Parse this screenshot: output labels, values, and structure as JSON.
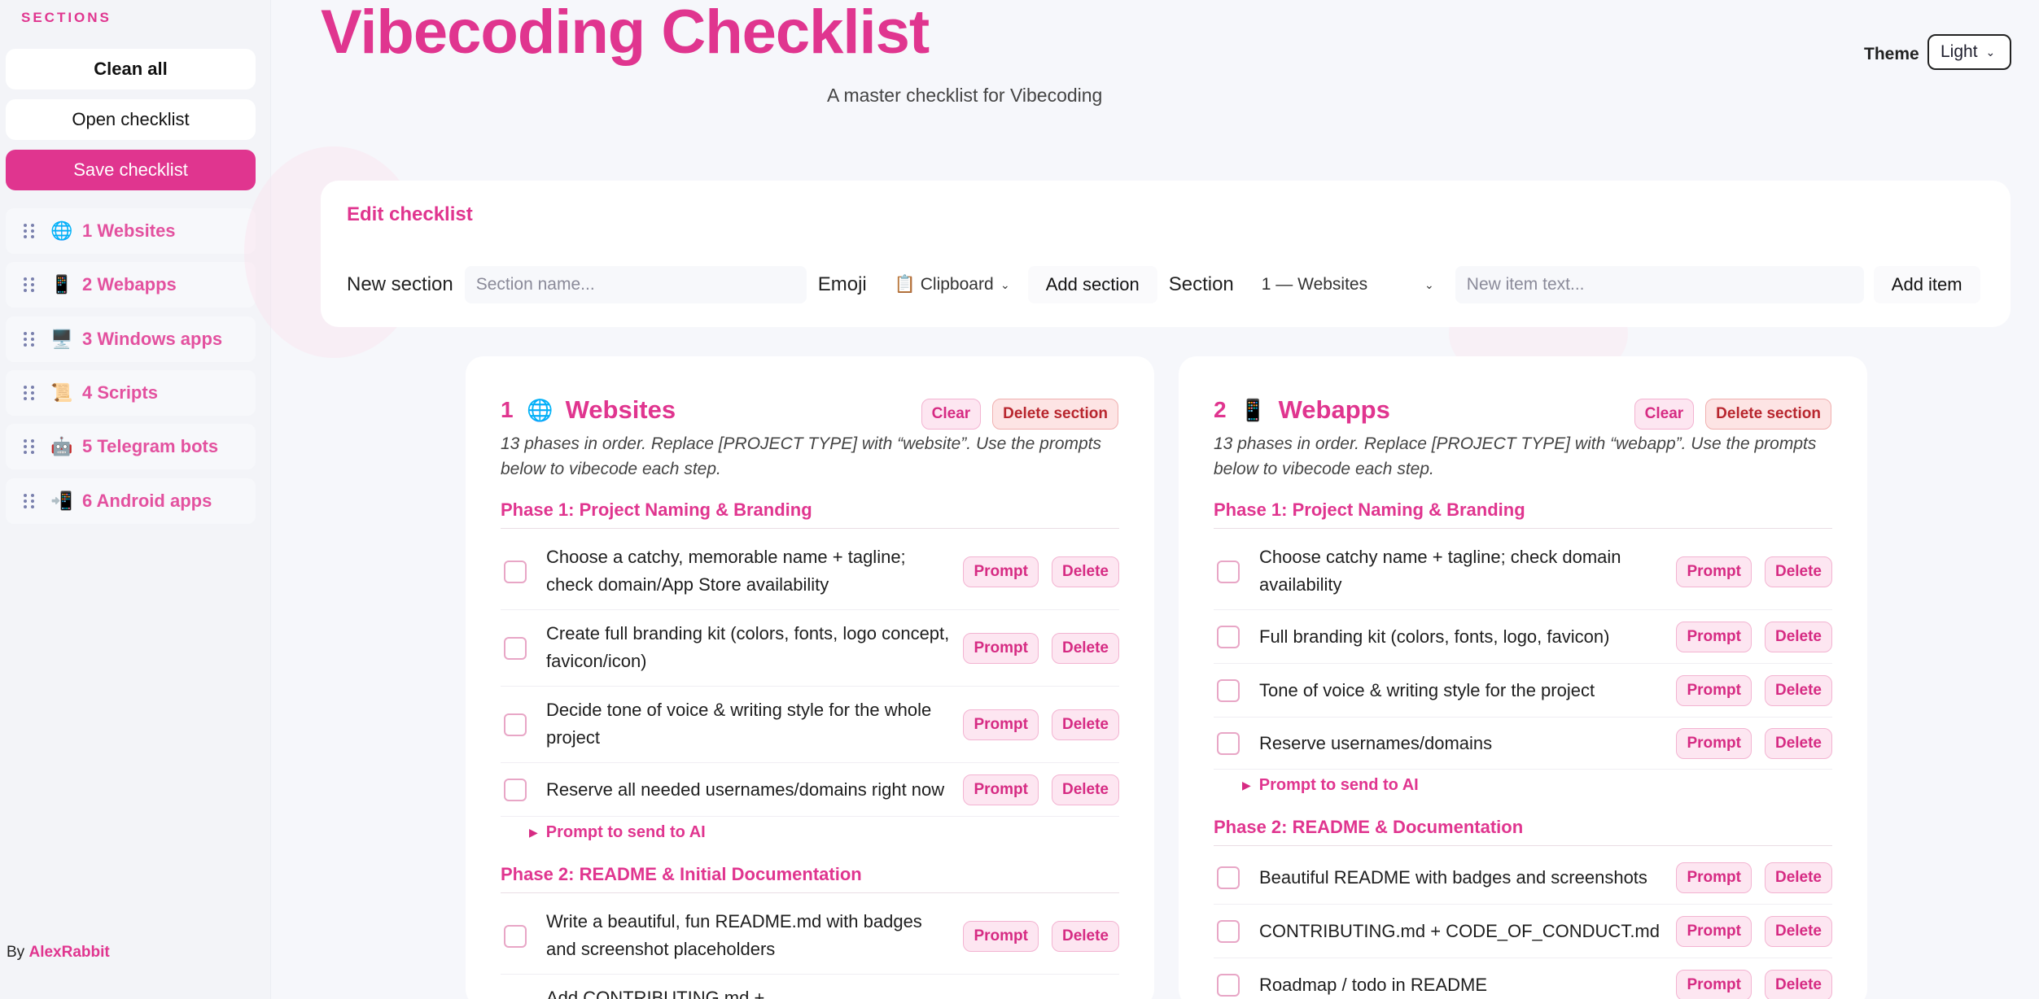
{
  "sidebar": {
    "heading": "SECTIONS",
    "clean_all": "Clean all",
    "open_checklist": "Open checklist",
    "save_checklist": "Save checklist",
    "items": [
      {
        "label": "1 Websites",
        "emoji": "🌐"
      },
      {
        "label": "2 Webapps",
        "emoji": "📱"
      },
      {
        "label": "3 Windows apps",
        "emoji": "🖥️"
      },
      {
        "label": "4 Scripts",
        "emoji": "📜"
      },
      {
        "label": "5 Telegram bots",
        "emoji": "🤖"
      },
      {
        "label": "6 Android apps",
        "emoji": "📲"
      }
    ],
    "by_prefix": "By",
    "author": "AlexRabbit"
  },
  "header": {
    "title": "Vibecoding Checklist",
    "subtitle": "A master checklist for Vibecoding",
    "theme_label": "Theme",
    "theme_value": "Light"
  },
  "edit": {
    "title": "Edit checklist",
    "new_section_label": "New section",
    "section_name_placeholder": "Section name...",
    "emoji_label": "Emoji",
    "emoji_value": "📋 Clipboard",
    "add_section": "Add section",
    "section_label": "Section",
    "section_value": "1 — Websites",
    "new_item_placeholder": "New item text...",
    "add_item": "Add item"
  },
  "cards": [
    {
      "num": "1",
      "emoji": "🌐",
      "title": "Websites",
      "clear": "Clear",
      "delete_section": "Delete section",
      "desc": "13 phases in order. Replace [PROJECT TYPE] with “website”. Use the prompts below to vibecode each step.",
      "phase1": "Phase 1: Project Naming & Branding",
      "items": [
        "Choose a catchy, memorable name + tagline; check domain/App Store availability",
        "Create full branding kit (colors, fonts, logo concept, favicon/icon)",
        "Decide tone of voice & writing style for the whole project",
        "Reserve all needed usernames/domains right now"
      ],
      "prompt_toggle": "Prompt to send to AI",
      "phase2": "Phase 2: README & Initial Documentation",
      "items2": [
        "Write a beautiful, fun README.md with badges and screenshot placeholders",
        "Add CONTRIBUTING.md +"
      ]
    },
    {
      "num": "2",
      "emoji": "📱",
      "title": "Webapps",
      "clear": "Clear",
      "delete_section": "Delete section",
      "desc": "13 phases in order. Replace [PROJECT TYPE] with “webapp”. Use the prompts below to vibecode each step.",
      "phase1": "Phase 1: Project Naming & Branding",
      "items": [
        "Choose catchy name + tagline; check domain availability",
        "Full branding kit (colors, fonts, logo, favicon)",
        "Tone of voice & writing style for the project",
        "Reserve usernames/domains"
      ],
      "prompt_toggle": "Prompt to send to AI",
      "phase2": "Phase 2: README & Documentation",
      "items2": [
        "Beautiful README with badges and screenshots",
        "CONTRIBUTING.md + CODE_OF_CONDUCT.md",
        "Roadmap / todo in README"
      ]
    }
  ],
  "labels": {
    "prompt": "Prompt",
    "delete": "Delete"
  }
}
